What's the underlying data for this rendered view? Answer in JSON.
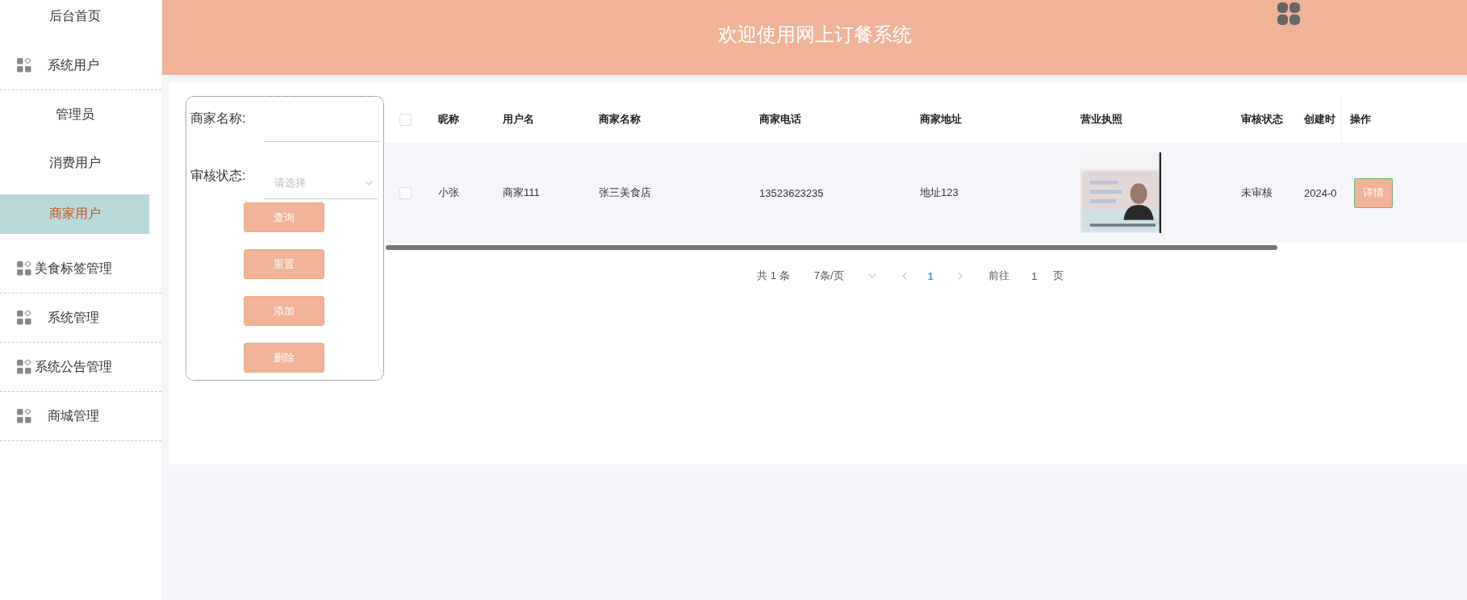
{
  "sidebar": {
    "items": [
      {
        "label": "后台首页",
        "icon": false,
        "selected": false
      },
      {
        "label": "系统用户",
        "icon": true,
        "selected": false,
        "children": [
          {
            "label": "管理员",
            "selected": false
          },
          {
            "label": "消费用户",
            "selected": false
          },
          {
            "label": "商家用户",
            "selected": true
          }
        ]
      },
      {
        "label": "美食标签管理",
        "icon": true,
        "selected": false
      },
      {
        "label": "系统管理",
        "icon": true,
        "selected": false
      },
      {
        "label": "系统公告管理",
        "icon": true,
        "selected": false
      },
      {
        "label": "商城管理",
        "icon": true,
        "selected": false
      }
    ]
  },
  "header": {
    "title": "欢迎使用网上订餐系统"
  },
  "search": {
    "fields": [
      {
        "kind": "input",
        "label": "商家名称:"
      },
      {
        "kind": "select",
        "label": "审核状态:",
        "placeholder": "请选择"
      }
    ],
    "buttons": [
      "查询",
      "重置",
      "添加",
      "删除"
    ]
  },
  "table": {
    "all_checked": false,
    "columns": [
      "昵称",
      "用户名",
      "商家名称",
      "商家电话",
      "商家地址",
      "营业执照",
      "审核状态",
      "创建时"
    ],
    "rows": [
      {
        "checked": false,
        "cells": [
          "小张",
          "商家111",
          "张三美食店",
          "13523623235",
          "地址123",
          {
            "kind": "picture"
          },
          "未审核",
          "2024-0"
        ],
        "action": "详情"
      }
    ],
    "fixed_column": {
      "header": "操作"
    }
  },
  "pagination": {
    "total": "共 1 条",
    "page_size": "7条/页",
    "pages": [
      {
        "label": "1",
        "selected": true
      }
    ],
    "jump_label": "前往",
    "jump_value": "1",
    "jump_suffix": "页"
  }
}
